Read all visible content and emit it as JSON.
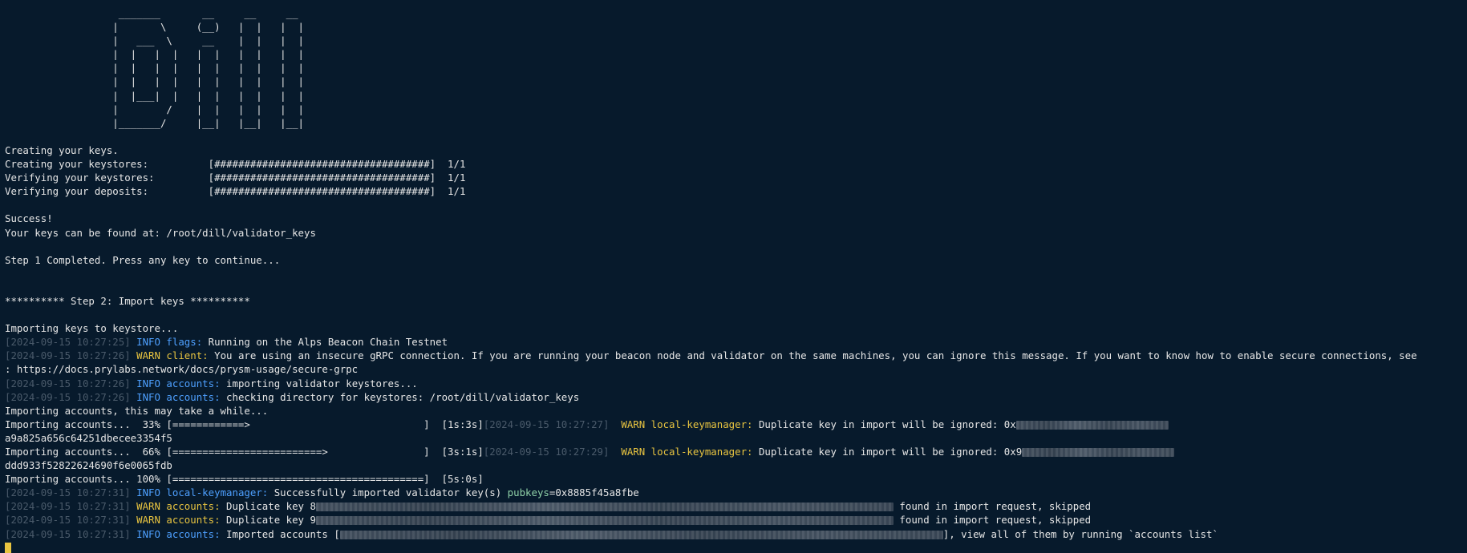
{
  "colors": {
    "background": "#071a2c",
    "text": "#e6e6e6",
    "timestamp": "#4a5a6a",
    "info_level": "#4ea0ff",
    "warn_level": "#e8c440",
    "key_value": "#8fd1a8",
    "cursor": "#e8c440"
  },
  "banner": [
    "                   _______       __     __     __",
    "                  |       \\     (__)   |  |   |  |",
    "                  |   ___  \\     __    |  |   |  |",
    "                  |  |   |  |   |  |   |  |   |  |",
    "                  |  |   |  |   |  |   |  |   |  |",
    "                  |  |   |  |   |  |   |  |   |  |",
    "                  |  |___|  |   |  |   |  |   |  |",
    "                  |        /    |  |   |  |   |  |",
    "                  |_______/     |__|   |__|   |__|"
  ],
  "keys_creation": {
    "title": "Creating your keys.",
    "rows": [
      {
        "label": "Creating your keystores:          ",
        "bar": "[####################################]",
        "count": "  1/1"
      },
      {
        "label": "Verifying your keystores:         ",
        "bar": "[####################################]",
        "count": "  1/1"
      },
      {
        "label": "Verifying your deposits:          ",
        "bar": "[####################################]",
        "count": "  1/1"
      }
    ],
    "success": "Success!",
    "location": "Your keys can be found at: /root/dill/validator_keys",
    "step1": "Step 1 Completed. Press any key to continue..."
  },
  "step2": {
    "header": "********** Step 2: Import keys **********",
    "importing": "Importing keys to keystore...",
    "log1": {
      "ts": "[2024-09-15 10:27:25]",
      "level": " INFO",
      "module": " flags:",
      "msg": " Running on the Alps Beacon Chain Testnet"
    },
    "log2": {
      "ts": "[2024-09-15 10:27:26]",
      "level": " WARN",
      "module": " client:",
      "msg": " You are using an insecure gRPC connection. If you are running your beacon node and validator on the same machines, you can ignore this message. If you want to know how to enable secure connections, see",
      "cont": ": https://docs.prylabs.network/docs/prysm-usage/secure-grpc"
    },
    "log3": {
      "ts": "[2024-09-15 10:27:26]",
      "level": " INFO",
      "module": " accounts:",
      "msg": " importing validator keystores..."
    },
    "log4": {
      "ts": "[2024-09-15 10:27:26]",
      "level": " INFO",
      "module": " accounts:",
      "msg": " checking directory for keystores: /root/dill/validator_keys"
    },
    "importing_accounts": "Importing accounts, this may take a while...",
    "progress1": {
      "text": "Importing accounts...  33% [============>                             ]  [1s:3s]",
      "ts": "[2024-09-15 10:27:27]",
      "level": "  WARN",
      "module": " local-keymanager:",
      "msg": " Duplicate key in import will be ignored: 0x",
      "cont": "a9a825a656c64251dbecee3354f5"
    },
    "progress2": {
      "text": "Importing accounts...  66% [=========================>                ]  [3s:1s]",
      "ts": "[2024-09-15 10:27:29]",
      "level": "  WARN",
      "module": " local-keymanager:",
      "msg": " Duplicate key in import will be ignored: 0x9",
      "cont": "ddd933f52822624690f6e0065fdb"
    },
    "progress3": "Importing accounts... 100% [==========================================]  [5s:0s]",
    "log5": {
      "ts": "[2024-09-15 10:27:31]",
      "level": " INFO",
      "module": " local-keymanager:",
      "msg": " Successfully imported validator key(s) ",
      "key": "pubkeys",
      "val": "=0x8885f45a8fbe"
    },
    "log6": {
      "ts": "[2024-09-15 10:27:31]",
      "level": " WARN",
      "module": " accounts:",
      "msg": " Duplicate key 8",
      "tail": " found in import request, skipped"
    },
    "log7": {
      "ts": "[2024-09-15 10:27:31]",
      "level": " WARN",
      "module": " accounts:",
      "msg": " Duplicate key 9",
      "tail": " found in import request, skipped"
    },
    "log8": {
      "ts": "[2024-09-15 10:27:31]",
      "level": " INFO",
      "module": " accounts:",
      "msg": " Imported accounts [",
      "tail": "], view all of them by running `accounts list`"
    }
  }
}
